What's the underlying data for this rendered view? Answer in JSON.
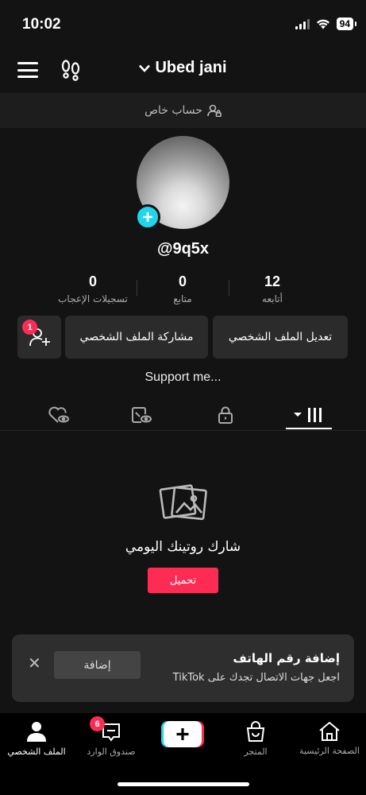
{
  "status_bar": {
    "time": "10:02",
    "battery": "94"
  },
  "header": {
    "username": "Ubed jani"
  },
  "account": {
    "private_label": "حساب خاص"
  },
  "profile": {
    "handle": "@9q5x"
  },
  "stats": [
    {
      "value": "12",
      "label": "أتابعه"
    },
    {
      "value": "0",
      "label": "متابع"
    },
    {
      "value": "0",
      "label": "تسجيلات الإعجاب"
    }
  ],
  "actions": {
    "edit_profile": "تعديل الملف الشخصي",
    "share_profile": "مشاركة الملف الشخصي",
    "add_friends_badge": "1"
  },
  "bio": "Support me...",
  "tabs": [
    "videos-tab",
    "private-tab",
    "reposts-tab",
    "liked-tab"
  ],
  "empty_state": {
    "title": "شارك روتينك اليومي",
    "upload_label": "تحميل"
  },
  "phone_card": {
    "title": "إضافة رقم الهاتف",
    "subtitle": "اجعل جهات الاتصال تجدك على TikTok",
    "add_label": "إضافة"
  },
  "bottom_nav": {
    "home": "الصفحة الرئيسية",
    "shop": "المتجر",
    "inbox": "صندوق الوارد",
    "inbox_badge": "6",
    "profile": "الملف الشخصي"
  },
  "colors": {
    "accent": "#fe2c55",
    "cyan": "#20d5ec",
    "background": "#131313"
  }
}
